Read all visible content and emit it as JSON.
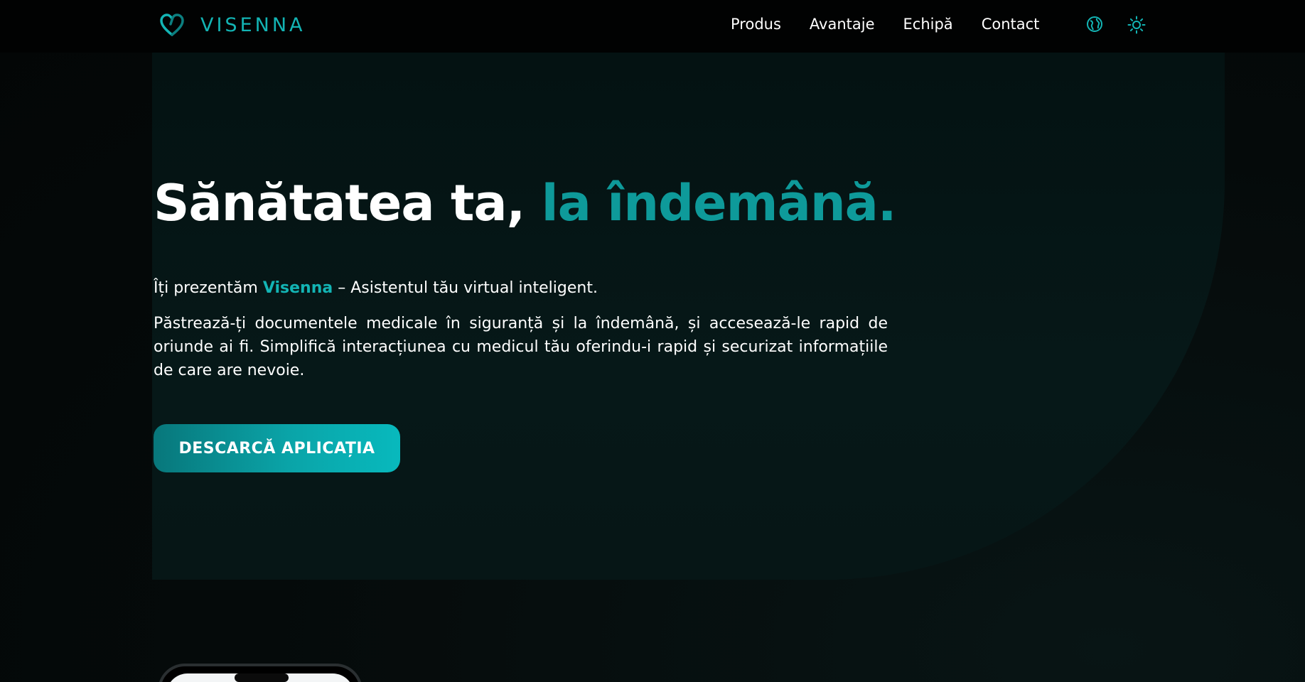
{
  "header": {
    "logo_text": "VISENNA",
    "logo_icon": "heart-logo-icon",
    "nav": [
      {
        "label": "Produs"
      },
      {
        "label": "Avantaje"
      },
      {
        "label": "Echipă"
      },
      {
        "label": "Contact"
      }
    ],
    "globe_icon": "globe-icon",
    "theme_icon": "sun-icon"
  },
  "hero": {
    "headline_part1": "Sănătatea ta, ",
    "headline_part2": "la îndemână.",
    "intro_prefix": "Îți prezentăm ",
    "intro_brand": "Visenna",
    "intro_suffix": " – Asistentul tău virtual inteligent.",
    "paragraph": "Păstrează-ți documentele medicale în siguranță și la îndemână, și accesează-le rapid de oriunde ai fi. Simplifică interacțiunea cu medicul tău oferindu-i rapid și securizat informațiile de care are nevoie.",
    "cta_label": "DESCARCĂ APLICAȚIA"
  },
  "colors": {
    "accent": "#13b4b4",
    "headline_accent": "#0e9a9a",
    "background": "#050909",
    "header_bg": "#010202"
  }
}
